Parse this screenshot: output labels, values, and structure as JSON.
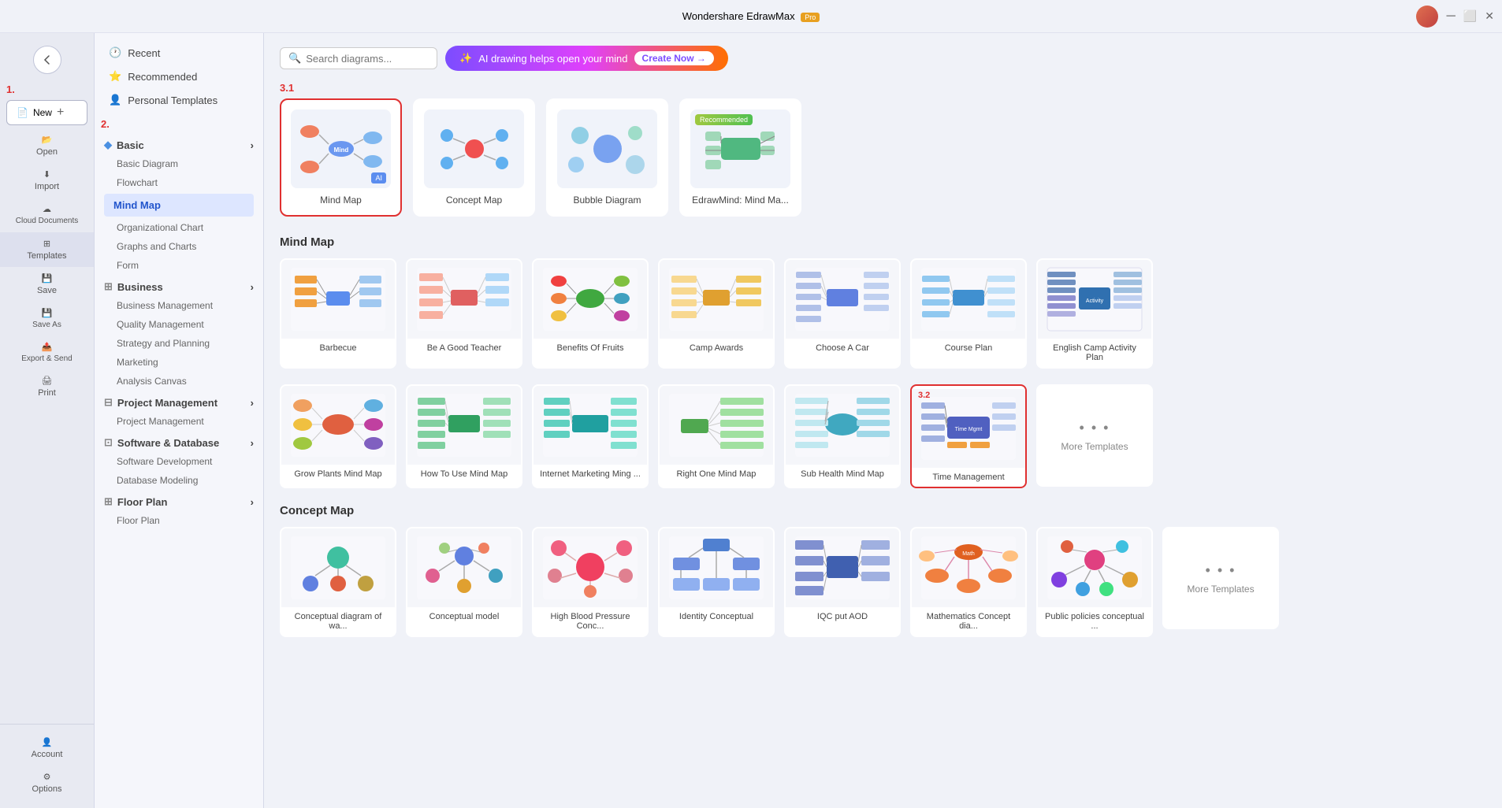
{
  "app": {
    "title": "Wondershare EdrawMax",
    "pro_label": "Pro"
  },
  "left_panel": {
    "new_label": "New",
    "open_label": "Open",
    "import_label": "Import",
    "cloud_label": "Cloud Documents",
    "templates_label": "Templates",
    "save_label": "Save",
    "save_as_label": "Save As",
    "export_label": "Export & Send",
    "print_label": "Print",
    "account_label": "Account",
    "options_label": "Options",
    "step1": "1.",
    "step2": "2."
  },
  "sidebar": {
    "recent_label": "Recent",
    "recommended_label": "Recommended",
    "personal_label": "Personal Templates",
    "basic_label": "Basic",
    "basic_diagram_label": "Basic Diagram",
    "flowchart_label": "Flowchart",
    "mindmap_label": "Mind Map",
    "org_chart_label": "Organizational Chart",
    "graphs_label": "Graphs and Charts",
    "form_label": "Form",
    "business_label": "Business",
    "biz_mgmt_label": "Business Management",
    "quality_label": "Quality Management",
    "strategy_label": "Strategy and Planning",
    "marketing_label": "Marketing",
    "analysis_label": "Analysis Canvas",
    "project_label": "Project Management",
    "project_mgmt_label": "Project Management",
    "software_label": "Software & Database",
    "software_dev_label": "Software Development",
    "db_modeling_label": "Database Modeling",
    "floor_label": "Floor Plan",
    "floor_plan_label": "Floor Plan"
  },
  "search": {
    "placeholder": "Search diagrams..."
  },
  "ai_banner": {
    "text": "AI drawing helps open your mind",
    "cta": "Create Now →"
  },
  "top_section": {
    "step_label": "3.1",
    "items": [
      {
        "id": "mind-map",
        "label": "Mind Map",
        "selected": true,
        "ai": true
      },
      {
        "id": "concept-map",
        "label": "Concept Map",
        "selected": false
      },
      {
        "id": "bubble-diagram",
        "label": "Bubble Diagram",
        "selected": false
      },
      {
        "id": "edrawmind",
        "label": "EdrawMind: Mind Ma...",
        "selected": false,
        "recommended": true
      }
    ]
  },
  "mindmap_section": {
    "title": "Mind Map",
    "step_label": "3.2",
    "items": [
      {
        "id": "barbecue",
        "label": "Barbecue"
      },
      {
        "id": "good-teacher",
        "label": "Be A Good Teacher"
      },
      {
        "id": "benefits-fruits",
        "label": "Benefits Of Fruits"
      },
      {
        "id": "camp-awards",
        "label": "Camp Awards"
      },
      {
        "id": "choose-car",
        "label": "Choose A Car"
      },
      {
        "id": "course-plan",
        "label": "Course Plan"
      },
      {
        "id": "english-camp",
        "label": "English Camp Activity Plan"
      },
      {
        "id": "grow-plants",
        "label": "Grow Plants Mind Map"
      },
      {
        "id": "how-to-use",
        "label": "How To Use Mind Map"
      },
      {
        "id": "internet-mktg",
        "label": "Internet Marketing Ming ..."
      },
      {
        "id": "right-one",
        "label": "Right One Mind Map"
      },
      {
        "id": "sub-health",
        "label": "Sub Health Mind Map"
      },
      {
        "id": "time-mgmt",
        "label": "Time Management",
        "highlighted": true
      },
      {
        "id": "more-mindmap",
        "label": "More Templates",
        "more": true
      }
    ]
  },
  "concept_section": {
    "title": "Concept Map",
    "items": [
      {
        "id": "conceptual-diagram",
        "label": "Conceptual diagram of wa..."
      },
      {
        "id": "conceptual-model",
        "label": "Conceptual model"
      },
      {
        "id": "high-blood",
        "label": "High Blood Pressure Conc..."
      },
      {
        "id": "identity",
        "label": "Identity Conceptual"
      },
      {
        "id": "iqc-put-aod",
        "label": "IQC put AOD"
      },
      {
        "id": "math-concept",
        "label": "Mathematics Concept dia..."
      },
      {
        "id": "public-policies",
        "label": "Public policies conceptual ..."
      },
      {
        "id": "more-concept",
        "label": "More Templates",
        "more": true
      }
    ]
  }
}
